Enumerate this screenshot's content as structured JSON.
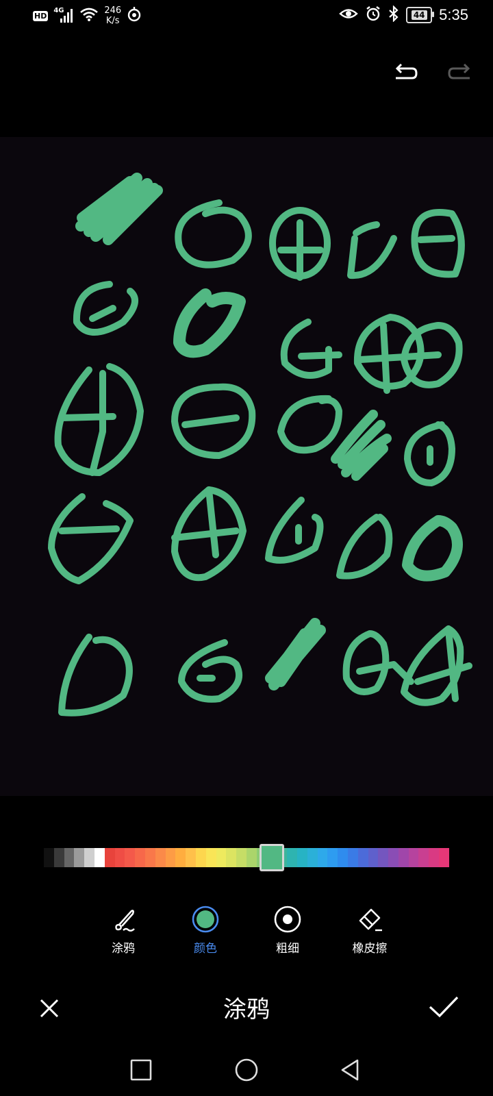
{
  "status_bar": {
    "hd_badge": "HD",
    "network_type": "4G",
    "net_speed_value": "246",
    "net_speed_unit": "K/s",
    "battery_level": "44",
    "time": "5:35",
    "icons": [
      "signal-icon",
      "wifi-icon",
      "hotspot-icon",
      "eye-icon",
      "alarm-icon",
      "bluetooth-icon",
      "battery-icon"
    ]
  },
  "toolbar_top": {
    "icons": [
      "undo-icon",
      "redo-icon"
    ]
  },
  "canvas": {
    "stroke_color": "#52b883",
    "background": "#0b070d"
  },
  "palette": {
    "colors": [
      "#111111",
      "#3a3a3a",
      "#666666",
      "#9b9b9b",
      "#cfcfcf",
      "#ffffff",
      "#e8433c",
      "#ef4d45",
      "#f4594a",
      "#f7684a",
      "#f9784a",
      "#fb8a49",
      "#fd9c45",
      "#ffad3f",
      "#ffc04a",
      "#fdd64e",
      "#f9e557",
      "#eeea5e",
      "#dce461",
      "#c6dd66",
      "#abd56b",
      "#8ccc73",
      "#52b883",
      "#3fb59b",
      "#2eb4b0",
      "#27b3c4",
      "#2bb0d8",
      "#2ea9ea",
      "#2e9cf0",
      "#2f8cee",
      "#3a7be6",
      "#4c6bd9",
      "#5f60cc",
      "#7456bf",
      "#8a4db5",
      "#a046aa",
      "#b6439e",
      "#c93f91",
      "#d93a83",
      "#e63777"
    ],
    "selected_color": "#52b883"
  },
  "tools": [
    {
      "label": "涂鸦",
      "icon": "brush-icon"
    },
    {
      "label": "颜色",
      "icon": "color-icon"
    },
    {
      "label": "粗细",
      "icon": "thickness-icon"
    },
    {
      "label": "橡皮擦",
      "icon": "eraser-icon"
    }
  ],
  "active_tool": "颜色",
  "bottom_bar": {
    "title": "涂鸦",
    "icons": [
      "close-icon",
      "check-icon"
    ]
  },
  "nav_bar": {
    "icons": [
      "recent-apps-icon",
      "home-icon",
      "back-icon"
    ]
  }
}
